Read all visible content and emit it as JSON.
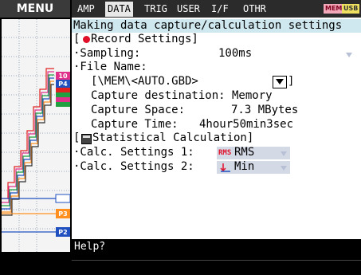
{
  "menu": {
    "label": "MENU"
  },
  "tabs": [
    {
      "label": "AMP",
      "active": false
    },
    {
      "label": "DATA",
      "active": true
    },
    {
      "label": "TRIG",
      "active": false
    },
    {
      "label": "USER",
      "active": false
    },
    {
      "label": "I/F",
      "active": false
    },
    {
      "label": "OTHR",
      "active": false
    }
  ],
  "badges": {
    "mem": "MEM",
    "usb": "USB"
  },
  "header": {
    "title": "Making data capture/calculation settings"
  },
  "record": {
    "section_title": "Record Settings]",
    "section_bracket": "[",
    "sampling_label": "·Sampling:",
    "sampling_value": "100ms",
    "filename_label": "·File Name:",
    "filename_value": "[\\MEM\\<AUTO.GBD>",
    "filename_close": "]",
    "capture_dest": "Capture destination: Memory",
    "capture_space_label": "Capture Space:",
    "capture_space_value": "7.3 MBytes",
    "capture_time_label": "Capture Time:",
    "capture_time_value": "4hour50min3sec"
  },
  "stats": {
    "section_title": "Statistical Calculation]",
    "section_bracket": "[",
    "calc1_label": "·Calc. Settings 1:",
    "calc1_icon": "RMS",
    "calc1_value": "RMS",
    "calc2_label": "·Calc. Settings 2:",
    "calc2_value": "Min"
  },
  "channel_labels": {
    "p4_top": "10",
    "p4": "P4",
    "p3": "P3",
    "p2": "P2"
  },
  "help": {
    "text": "Help?"
  },
  "colors": {
    "record_dot": "#e0102a",
    "header_band": "#cfe8ef",
    "tab_active_bg": "#e8e8e8",
    "badge_mem": "#f2a8b8",
    "badge_usb": "#f0e060",
    "graph_pink": "#e0308a",
    "graph_green": "#20a040",
    "graph_orange": "#ff9020",
    "graph_blue": "#2050c0",
    "graph_red": "#e02020"
  }
}
